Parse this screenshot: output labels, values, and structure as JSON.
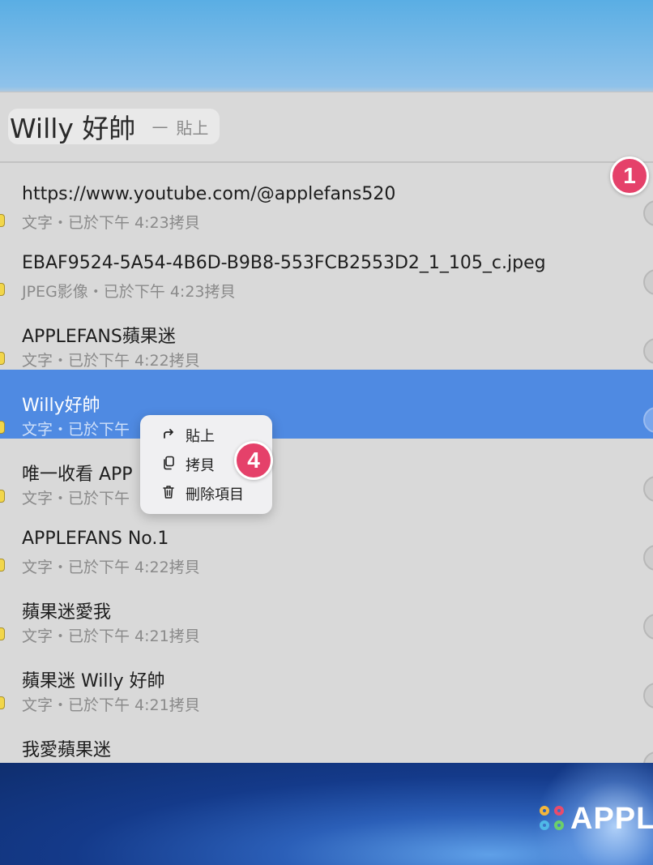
{
  "search": {
    "query": "Willy 好帥",
    "separator": "—",
    "action_hint": "貼上"
  },
  "clipboard_items": [
    {
      "title": "https://www.youtube.com/@applefans520",
      "meta": "文字・已於下午 4:23拷貝"
    },
    {
      "title": "EBAF9524-5A54-4B6D-B9B8-553FCB2553D2_1_105_c.jpeg",
      "meta": "JPEG影像・已於下午 4:23拷貝"
    },
    {
      "title": "APPLEFANS蘋果迷",
      "meta": "文字・已於下午 4:22拷貝"
    },
    {
      "title": "Willy好帥",
      "meta": "文字・已於下午",
      "selected": true
    },
    {
      "title": "唯一收看 APP",
      "meta": "文字・已於下午"
    },
    {
      "title": "APPLEFANS No.1",
      "meta": "文字・已於下午 4:22拷貝"
    },
    {
      "title": "蘋果迷愛我",
      "meta": "文字・已於下午 4:21拷貝"
    },
    {
      "title": "蘋果迷 Willy 好帥",
      "meta": "文字・已於下午 4:21拷貝"
    },
    {
      "title": "我愛蘋果迷",
      "meta": ""
    }
  ],
  "context_menu": {
    "items": [
      {
        "label": "貼上",
        "icon": "paste-arrow-icon"
      },
      {
        "label": "拷貝",
        "icon": "copy-icon"
      },
      {
        "label": "刪除項目",
        "icon": "trash-icon"
      }
    ]
  },
  "badges": {
    "step_one": "1",
    "step_four": "4",
    "color": "#e5416a"
  },
  "watermark": {
    "text": "APPL"
  },
  "colors": {
    "selection": "#4f8ae2",
    "panel": "#d9d9d9"
  }
}
